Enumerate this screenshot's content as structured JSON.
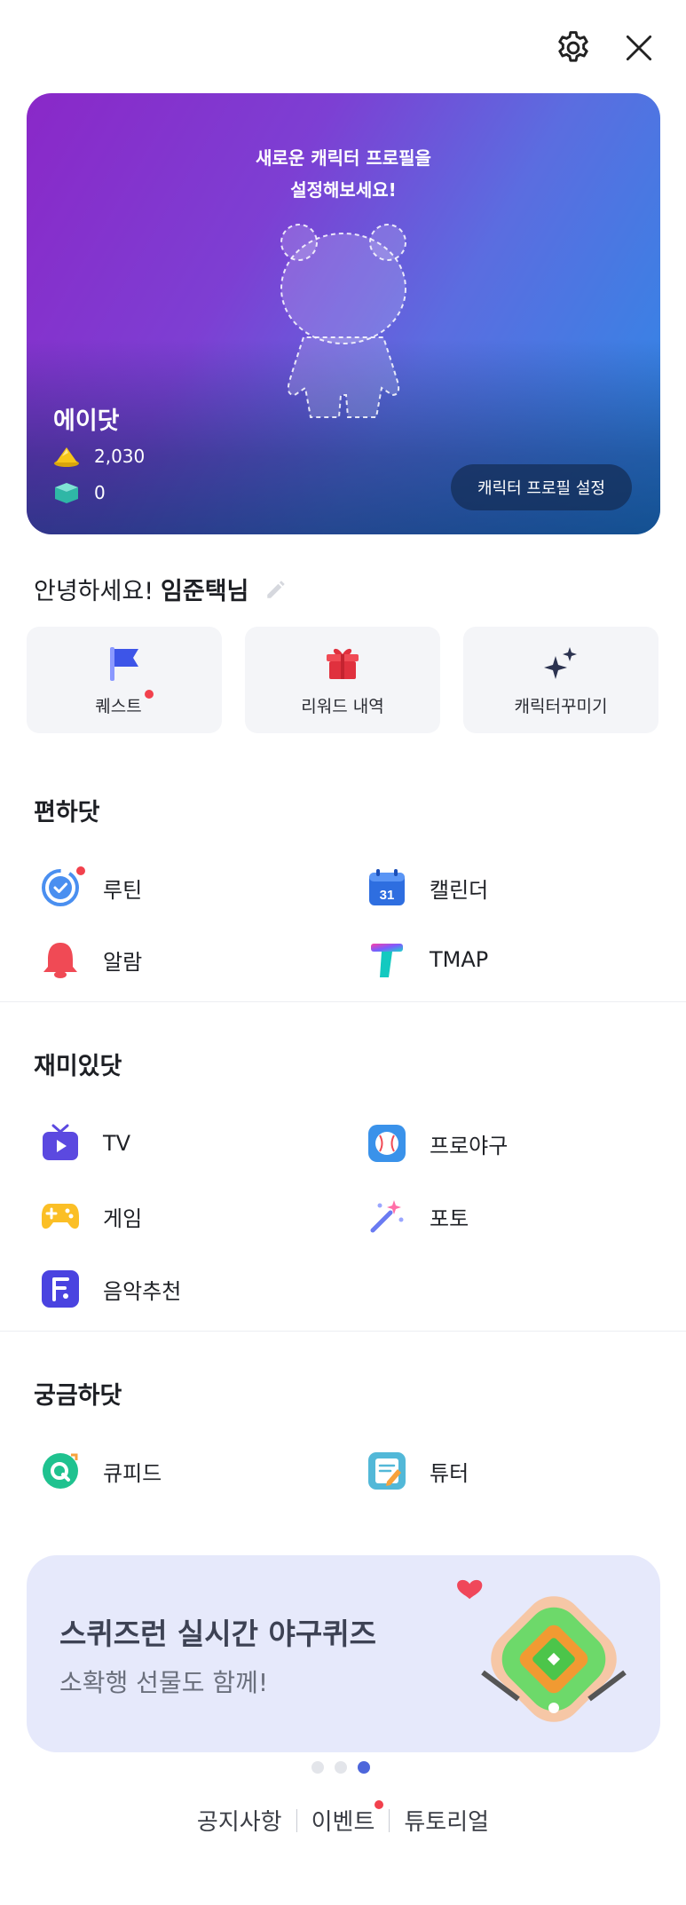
{
  "hero": {
    "prompt": "새로운 캐릭터 프로필을\n설정해보세요!",
    "name": "에이닷",
    "coins": "2,030",
    "gems": "0",
    "button": "캐릭터 프로필 설정"
  },
  "greeting": {
    "prefix": "안녕하세요!",
    "user": "임준택님"
  },
  "tiles": [
    {
      "label": "퀘스트",
      "icon": "flag-icon",
      "badge": true
    },
    {
      "label": "리워드 내역",
      "icon": "gift-icon",
      "badge": false
    },
    {
      "label": "캐릭터꾸미기",
      "icon": "sparkle-icon",
      "badge": false
    }
  ],
  "sections": {
    "convenience": {
      "title": "편하닷",
      "items": [
        {
          "label": "루틴",
          "icon": "routine-icon",
          "badge": true
        },
        {
          "label": "캘린더",
          "icon": "calendar-icon",
          "badge": false,
          "calendar_day": "31"
        },
        {
          "label": "알람",
          "icon": "bell-icon",
          "badge": false
        },
        {
          "label": "TMAP",
          "icon": "tmap-icon",
          "badge": false
        }
      ]
    },
    "fun": {
      "title": "재미있닷",
      "items": [
        {
          "label": "TV",
          "icon": "tv-icon"
        },
        {
          "label": "프로야구",
          "icon": "baseball-icon"
        },
        {
          "label": "게임",
          "icon": "gamepad-icon"
        },
        {
          "label": "포토",
          "icon": "magic-wand-icon"
        },
        {
          "label": "음악추천",
          "icon": "music-icon"
        }
      ]
    },
    "curious": {
      "title": "궁금하닷",
      "items": [
        {
          "label": "큐피드",
          "icon": "qpid-icon"
        },
        {
          "label": "튜터",
          "icon": "tutor-icon"
        }
      ]
    }
  },
  "banner": {
    "title": "스퀴즈런 실시간 야구퀴즈",
    "subtitle": "소확행 선물도 함께!",
    "page_count": 3,
    "active_page": 3
  },
  "footer": {
    "links": [
      "공지사항",
      "이벤트",
      "튜토리얼"
    ],
    "event_badge": true
  },
  "colors": {
    "accent": "#4d66db",
    "badge": "#f2414d",
    "banner_bg": "#e6e9fb"
  }
}
